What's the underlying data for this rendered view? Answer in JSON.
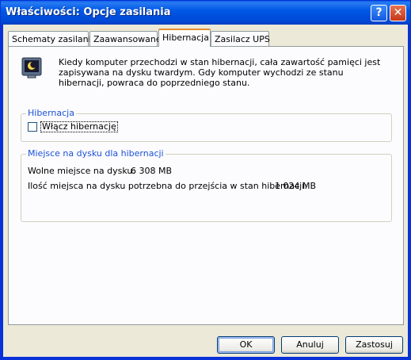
{
  "window": {
    "title": "Właściwości: Opcje zasilania",
    "help_label": "?",
    "close_label": "✕"
  },
  "tabs": [
    {
      "label": "Schematy zasilania"
    },
    {
      "label": "Zaawansowane"
    },
    {
      "label": "Hibernacja"
    },
    {
      "label": "Zasilacz UPS"
    }
  ],
  "active_tab": "Hibernacja",
  "intro": {
    "icon": "monitor-moon-icon",
    "text": "Kiedy komputer przechodzi w stan hibernacji, cała zawartość pamięci jest zapisywana na dysku twardym. Gdy komputer wychodzi ze stanu hibernacji, powraca do poprzedniego stanu."
  },
  "hibernation_group": {
    "label": "Hibernacja",
    "checkbox_label": "Włącz hibernację",
    "checked": false
  },
  "disk_group": {
    "label": "Miejsce na dysku dla hibernacji",
    "free_label": "Wolne miejsce na dysku:",
    "free_value": "6 308 MB",
    "required_label": "Ilość miejsca na dysku potrzebna do przejścia w stan hibernacji:",
    "required_value": "1 024 MB"
  },
  "buttons": {
    "ok": "OK",
    "cancel": "Anuluj",
    "apply": "Zastosuj"
  },
  "colors": {
    "titlebar": "#0058e6",
    "accent_tab": "#e68b2c",
    "group_label": "#1c51d7",
    "dialog_bg": "#ece9d8"
  }
}
